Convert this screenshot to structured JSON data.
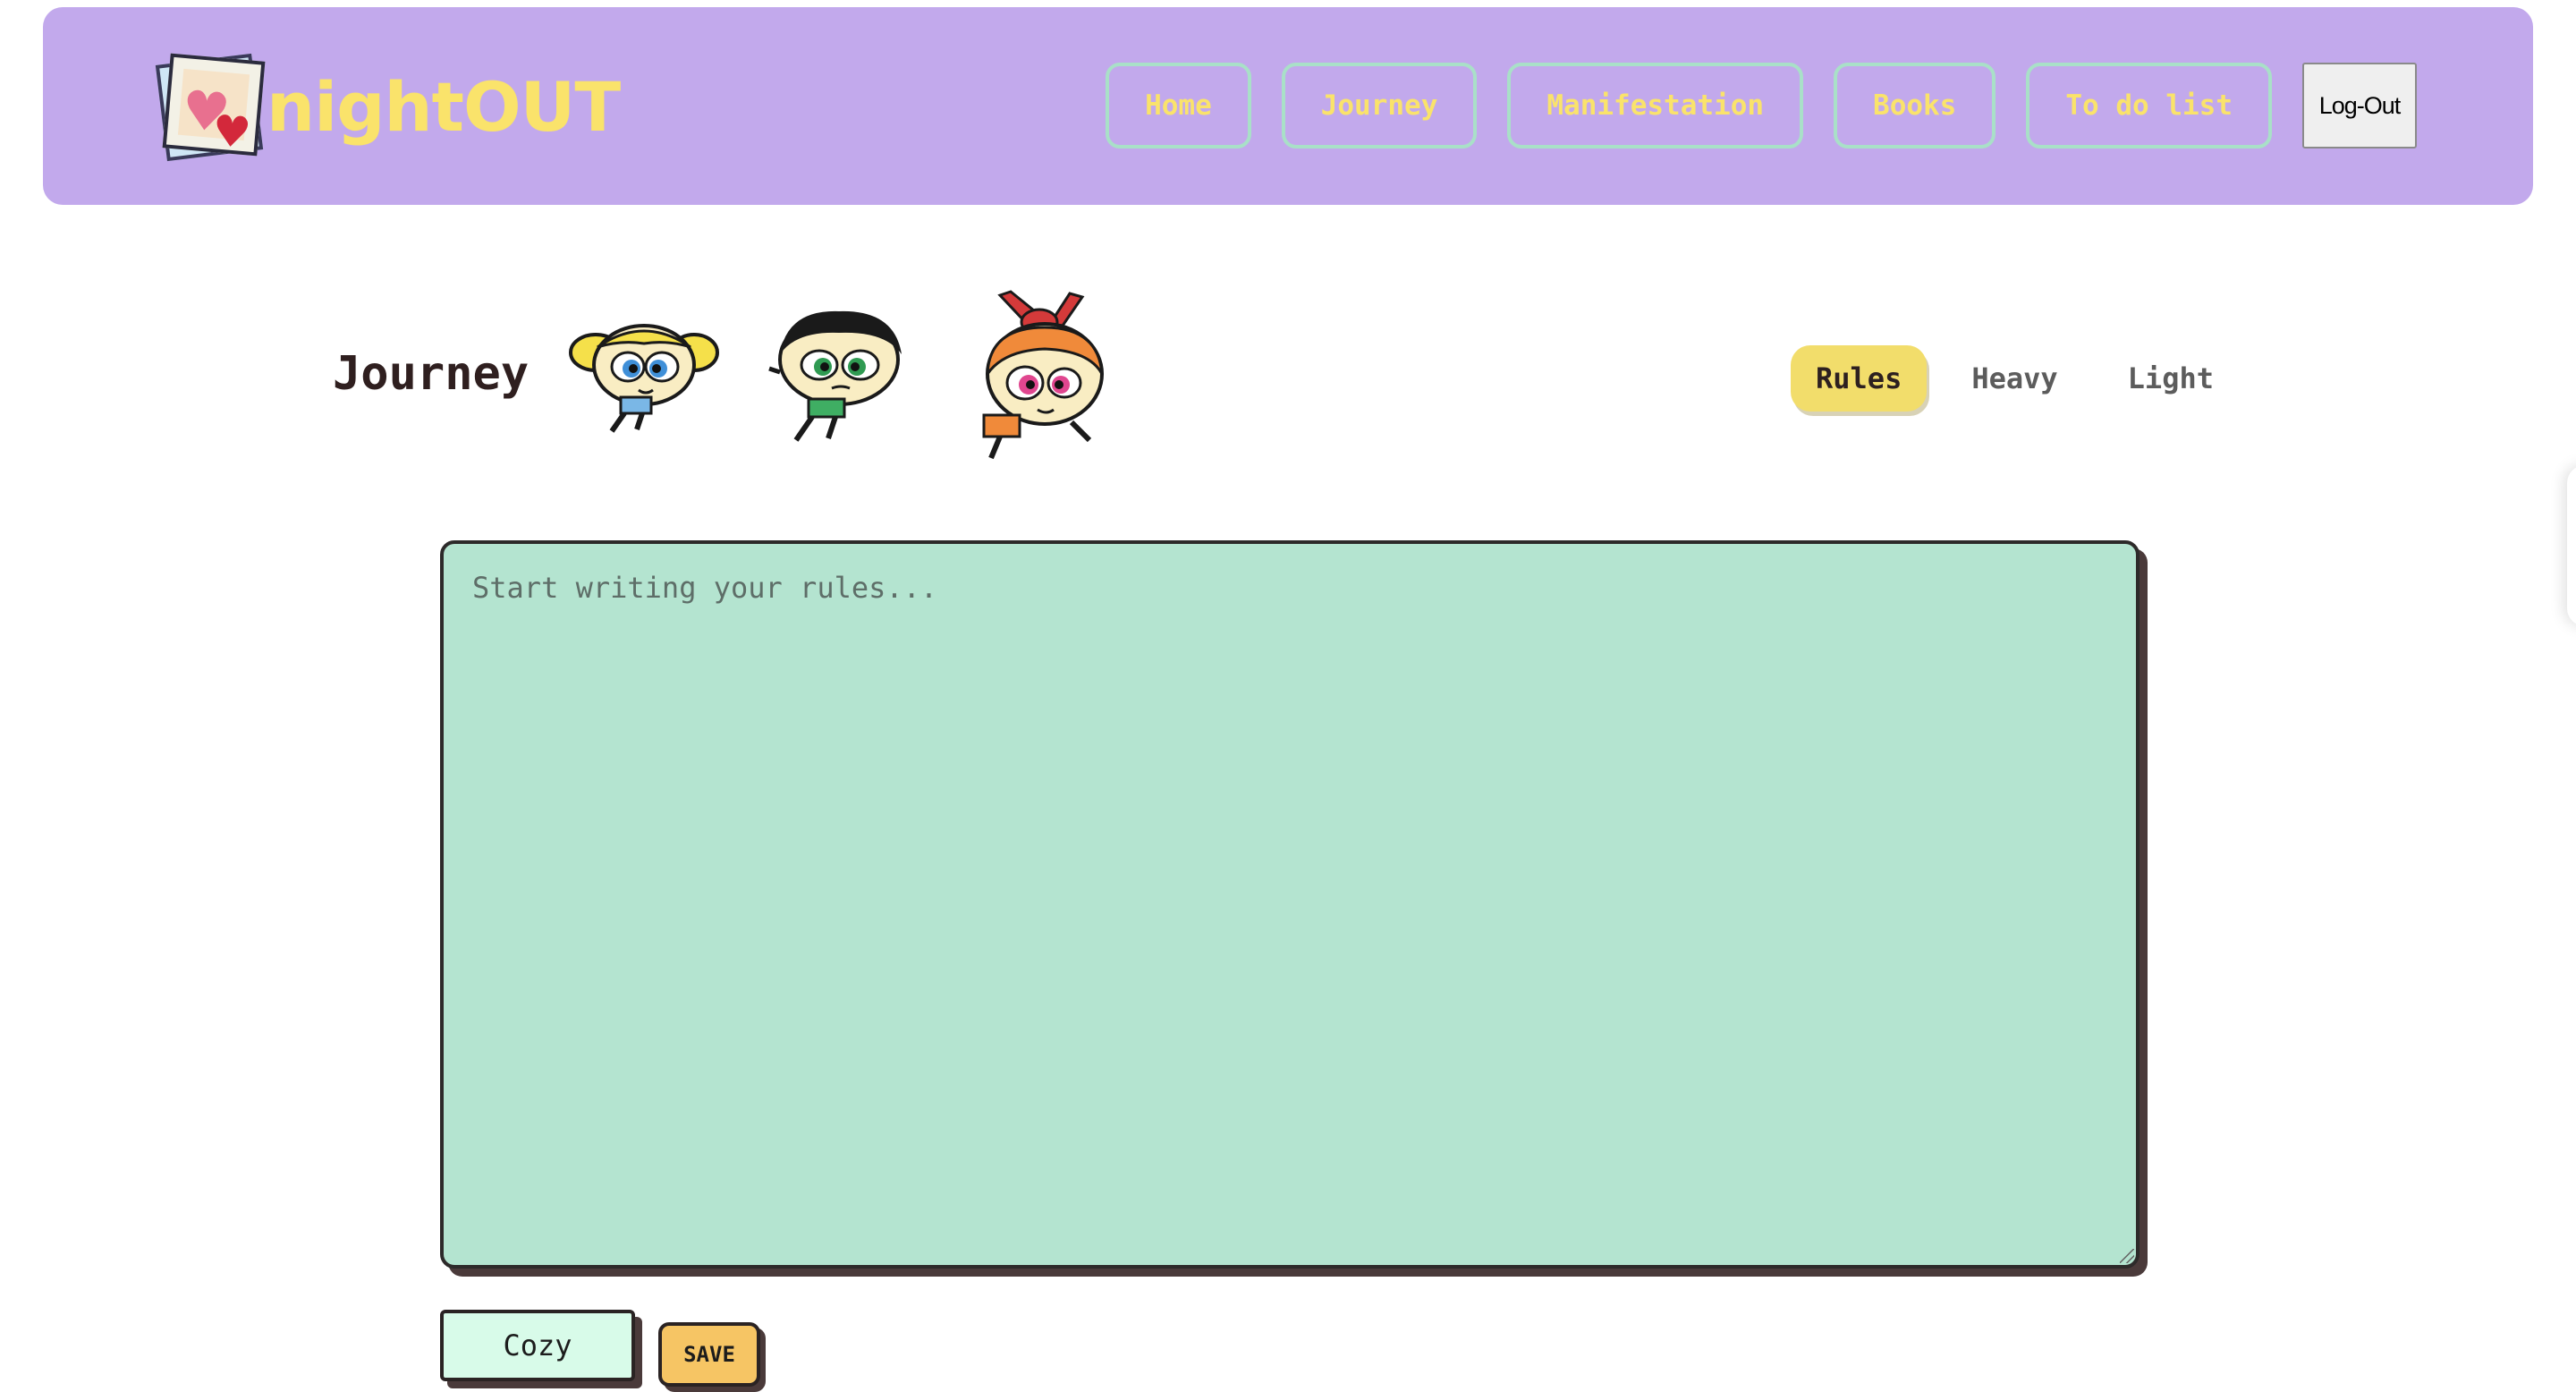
{
  "header": {
    "brand_name": "nightOUT",
    "logo_icon": "polaroid-hearts-icon",
    "nav": [
      {
        "label": "Home"
      },
      {
        "label": "Journey"
      },
      {
        "label": "Manifestation"
      },
      {
        "label": "Books"
      },
      {
        "label": "To do list"
      }
    ],
    "logout_label": "Log-Out"
  },
  "main": {
    "title": "Journey",
    "characters": [
      "bubbles-pixel-sprite",
      "buttercup-pixel-sprite",
      "blossom-pixel-sprite"
    ],
    "tabs": [
      {
        "label": "Rules",
        "active": true
      },
      {
        "label": "Heavy",
        "active": false
      },
      {
        "label": "Light",
        "active": false
      }
    ],
    "editor": {
      "placeholder": "Start writing your rules...",
      "value": ""
    },
    "mood_label": "Cozy",
    "save_label": "SAVE"
  },
  "colors": {
    "header_bg": "#c2a9ec",
    "brand_yellow": "#fae36b",
    "nav_border": "#a9e0c8",
    "editor_bg": "#b4e4d0",
    "active_tab": "#f2dd6b",
    "save_bg": "#f6c564",
    "mood_bg": "#d8fbe9"
  }
}
